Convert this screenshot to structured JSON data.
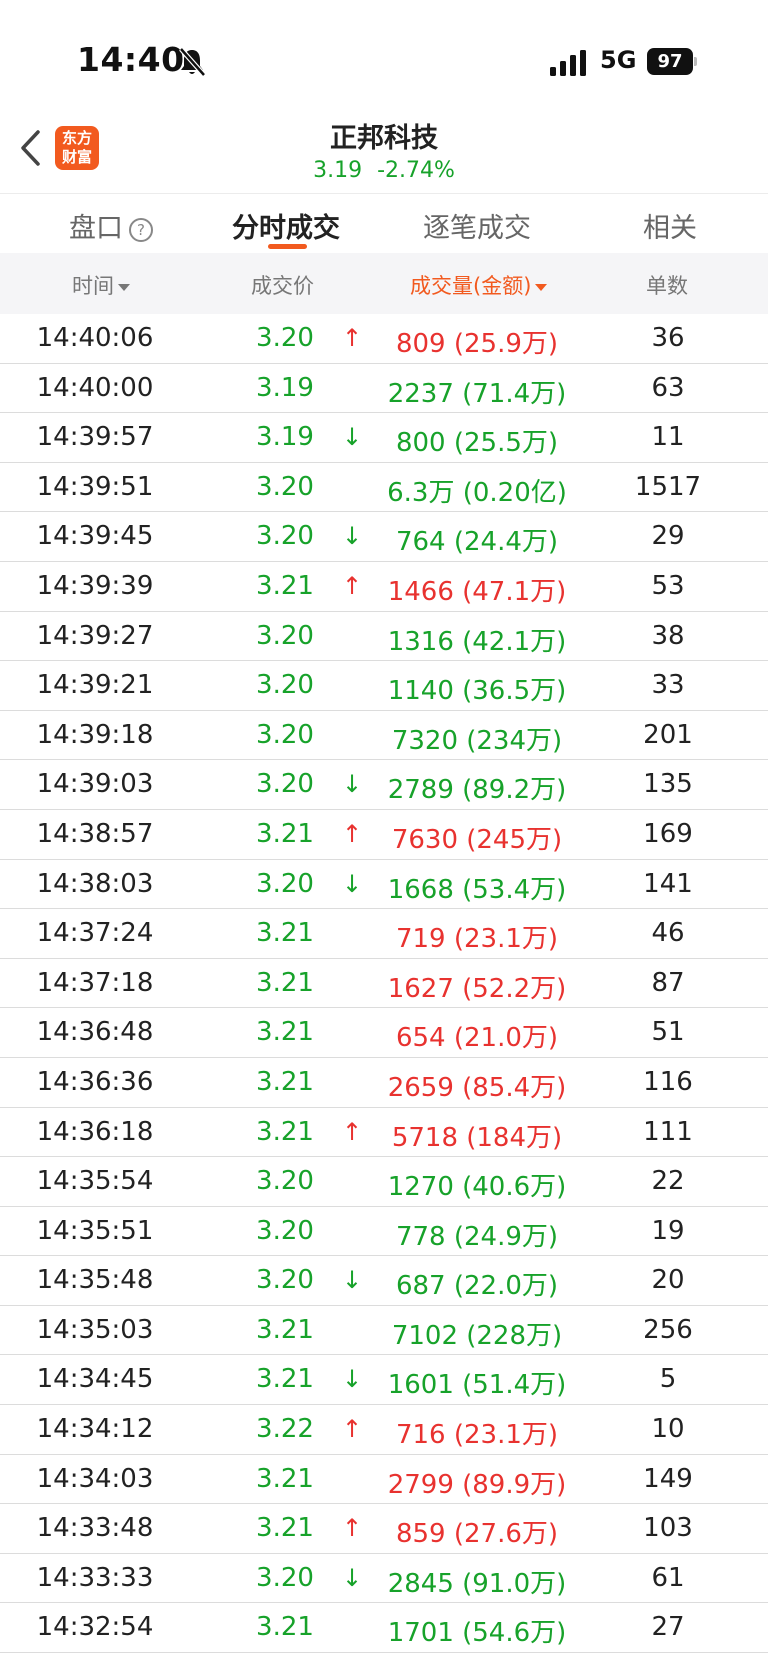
{
  "status_bar": {
    "time": "14:40",
    "network": "5G",
    "battery": "97"
  },
  "header": {
    "logo_line1": "东方",
    "logo_line2": "财富",
    "title": "正邦科技",
    "price": "3.19",
    "change_pct": "-2.74%"
  },
  "tabs": [
    {
      "label": "盘口"
    },
    {
      "label": "分时成交"
    },
    {
      "label": "逐笔成交"
    },
    {
      "label": "相关"
    }
  ],
  "help_glyph": "?",
  "columns": {
    "time": "时间",
    "price": "成交价",
    "volume": "成交量(金额)",
    "count": "单数"
  },
  "colors": {
    "up": "#e8322f",
    "down": "#17a22a",
    "accent": "#f25a1f"
  },
  "trades": [
    {
      "time": "14:40:06",
      "price": "3.20",
      "arrow": "↑",
      "volume": "809 (25.9万)",
      "count": "36",
      "vol_color": "red"
    },
    {
      "time": "14:40:00",
      "price": "3.19",
      "arrow": "",
      "volume": "2237 (71.4万)",
      "count": "63",
      "vol_color": "green"
    },
    {
      "time": "14:39:57",
      "price": "3.19",
      "arrow": "↓",
      "volume": "800 (25.5万)",
      "count": "11",
      "vol_color": "green"
    },
    {
      "time": "14:39:51",
      "price": "3.20",
      "arrow": "",
      "volume": "6.3万 (0.20亿)",
      "count": "1517",
      "vol_color": "green"
    },
    {
      "time": "14:39:45",
      "price": "3.20",
      "arrow": "↓",
      "volume": "764 (24.4万)",
      "count": "29",
      "vol_color": "green"
    },
    {
      "time": "14:39:39",
      "price": "3.21",
      "arrow": "↑",
      "volume": "1466 (47.1万)",
      "count": "53",
      "vol_color": "red"
    },
    {
      "time": "14:39:27",
      "price": "3.20",
      "arrow": "",
      "volume": "1316 (42.1万)",
      "count": "38",
      "vol_color": "green"
    },
    {
      "time": "14:39:21",
      "price": "3.20",
      "arrow": "",
      "volume": "1140 (36.5万)",
      "count": "33",
      "vol_color": "green"
    },
    {
      "time": "14:39:18",
      "price": "3.20",
      "arrow": "",
      "volume": "7320 (234万)",
      "count": "201",
      "vol_color": "green"
    },
    {
      "time": "14:39:03",
      "price": "3.20",
      "arrow": "↓",
      "volume": "2789 (89.2万)",
      "count": "135",
      "vol_color": "green"
    },
    {
      "time": "14:38:57",
      "price": "3.21",
      "arrow": "↑",
      "volume": "7630 (245万)",
      "count": "169",
      "vol_color": "red"
    },
    {
      "time": "14:38:03",
      "price": "3.20",
      "arrow": "↓",
      "volume": "1668 (53.4万)",
      "count": "141",
      "vol_color": "green"
    },
    {
      "time": "14:37:24",
      "price": "3.21",
      "arrow": "",
      "volume": "719 (23.1万)",
      "count": "46",
      "vol_color": "red"
    },
    {
      "time": "14:37:18",
      "price": "3.21",
      "arrow": "",
      "volume": "1627 (52.2万)",
      "count": "87",
      "vol_color": "red"
    },
    {
      "time": "14:36:48",
      "price": "3.21",
      "arrow": "",
      "volume": "654 (21.0万)",
      "count": "51",
      "vol_color": "red"
    },
    {
      "time": "14:36:36",
      "price": "3.21",
      "arrow": "",
      "volume": "2659 (85.4万)",
      "count": "116",
      "vol_color": "red"
    },
    {
      "time": "14:36:18",
      "price": "3.21",
      "arrow": "↑",
      "volume": "5718 (184万)",
      "count": "111",
      "vol_color": "red"
    },
    {
      "time": "14:35:54",
      "price": "3.20",
      "arrow": "",
      "volume": "1270 (40.6万)",
      "count": "22",
      "vol_color": "green"
    },
    {
      "time": "14:35:51",
      "price": "3.20",
      "arrow": "",
      "volume": "778 (24.9万)",
      "count": "19",
      "vol_color": "green"
    },
    {
      "time": "14:35:48",
      "price": "3.20",
      "arrow": "↓",
      "volume": "687 (22.0万)",
      "count": "20",
      "vol_color": "green"
    },
    {
      "time": "14:35:03",
      "price": "3.21",
      "arrow": "",
      "volume": "7102 (228万)",
      "count": "256",
      "vol_color": "green"
    },
    {
      "time": "14:34:45",
      "price": "3.21",
      "arrow": "↓",
      "volume": "1601 (51.4万)",
      "count": "5",
      "vol_color": "green"
    },
    {
      "time": "14:34:12",
      "price": "3.22",
      "arrow": "↑",
      "volume": "716 (23.1万)",
      "count": "10",
      "vol_color": "red"
    },
    {
      "time": "14:34:03",
      "price": "3.21",
      "arrow": "",
      "volume": "2799 (89.9万)",
      "count": "149",
      "vol_color": "red"
    },
    {
      "time": "14:33:48",
      "price": "3.21",
      "arrow": "↑",
      "volume": "859 (27.6万)",
      "count": "103",
      "vol_color": "red"
    },
    {
      "time": "14:33:33",
      "price": "3.20",
      "arrow": "↓",
      "volume": "2845 (91.0万)",
      "count": "61",
      "vol_color": "green"
    },
    {
      "time": "14:32:54",
      "price": "3.21",
      "arrow": "",
      "volume": "1701 (54.6万)",
      "count": "27",
      "vol_color": "green"
    }
  ]
}
